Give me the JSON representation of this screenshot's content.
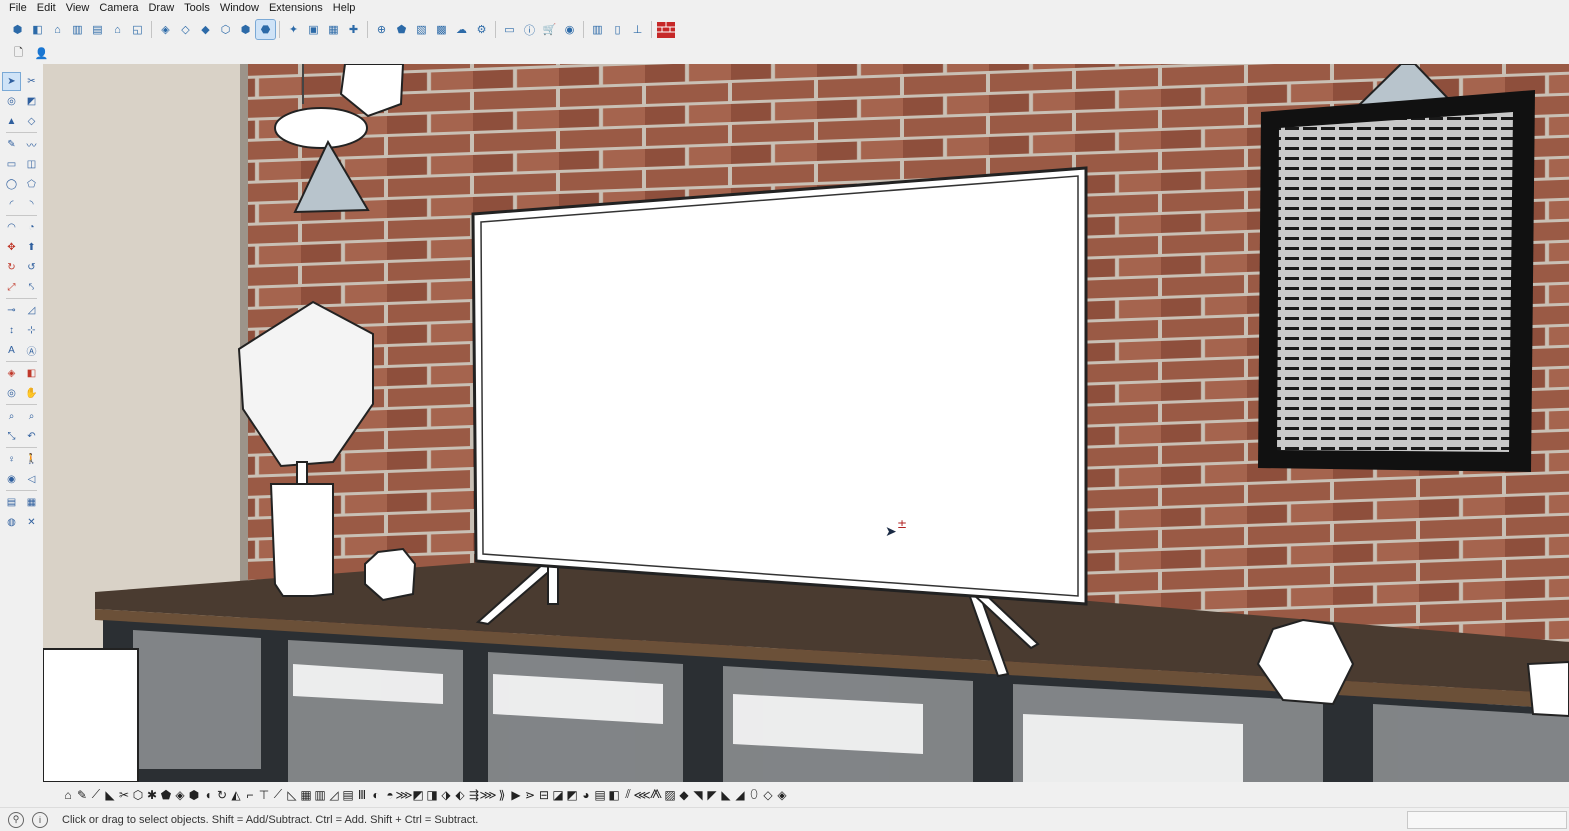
{
  "menu": [
    "File",
    "Edit",
    "View",
    "Camera",
    "Draw",
    "Tools",
    "Window",
    "Extensions",
    "Help"
  ],
  "toolbar_top": {
    "group_a": [
      "iso-view-icon",
      "top-view-icon",
      "front-view-icon",
      "right-view-icon",
      "back-view-icon",
      "left-view-icon",
      "bottom-view-icon"
    ],
    "group_b": [
      "xray-style-icon",
      "wireframe-style-icon",
      "hidden-line-style-icon",
      "shaded-style-icon",
      "textured-style-icon",
      "monochrome-style-icon"
    ],
    "group_c": [
      "warehouse-icon",
      "extension-warehouse-icon",
      "send-to-layout-icon",
      "component-icon"
    ],
    "group_d": [
      "add-location-icon",
      "geo-icon",
      "model-info-icon",
      "styles-icon",
      "cloud-icon",
      "settings-icon"
    ],
    "group_e": [
      "scenes-icon",
      "info-icon",
      "cart-icon",
      "account-icon"
    ],
    "group_f": [
      "section-plane-icon",
      "window-icon",
      "trim-icon"
    ],
    "red_tool": "red-brick-icon",
    "active_index": 12
  },
  "toolbar_second": [
    "new-file-icon",
    "user-icon"
  ],
  "left_tools": [
    [
      "select-arrow-icon",
      "paint-bucket-icon"
    ],
    [
      "lasso-icon",
      "eraser-icon"
    ],
    [
      "stamp-icon",
      "eraser-alt-icon"
    ],
    [
      "pencil-icon",
      "freehand-icon"
    ],
    [
      "rectangle-icon",
      "rotated-rectangle-icon"
    ],
    [
      "circle-icon",
      "polygon-icon"
    ],
    [
      "arc-icon",
      "two-point-arc-icon"
    ],
    [
      "three-point-arc-icon",
      "pie-icon"
    ],
    [
      "move-icon",
      "push-pull-icon"
    ],
    [
      "rotate-icon",
      "follow-me-icon"
    ],
    [
      "scale-icon",
      "offset-icon"
    ],
    [
      "tape-measure-icon",
      "protractor-icon"
    ],
    [
      "dimension-icon",
      "axes-icon"
    ],
    [
      "text-icon",
      "3d-text-icon"
    ],
    [
      "section-icon",
      "section-fill-icon"
    ],
    [
      "orbit-icon",
      "pan-icon"
    ],
    [
      "zoom-icon",
      "zoom-window-icon"
    ],
    [
      "zoom-extents-icon",
      "previous-view-icon"
    ],
    [
      "position-camera-icon",
      "walk-icon"
    ],
    [
      "look-around-icon",
      "field-of-view-icon"
    ],
    [
      "layers-icon",
      "outliner-icon"
    ],
    [
      "solid-tools-icon",
      "sandbox-icon"
    ]
  ],
  "scene": {
    "description_hidden": true,
    "wall_color": "#9a5a45",
    "mortar_color": "#c9c0b5",
    "cabinet_top_color": "#4a3b30",
    "cabinet_frame_color": "#2b2f33",
    "cursor_symbol": "±"
  },
  "bottom_tools_count": 52,
  "status": {
    "text": "Click or drag to select objects. Shift = Add/Subtract. Ctrl = Add. Shift + Ctrl = Subtract.",
    "info_label": "i"
  }
}
